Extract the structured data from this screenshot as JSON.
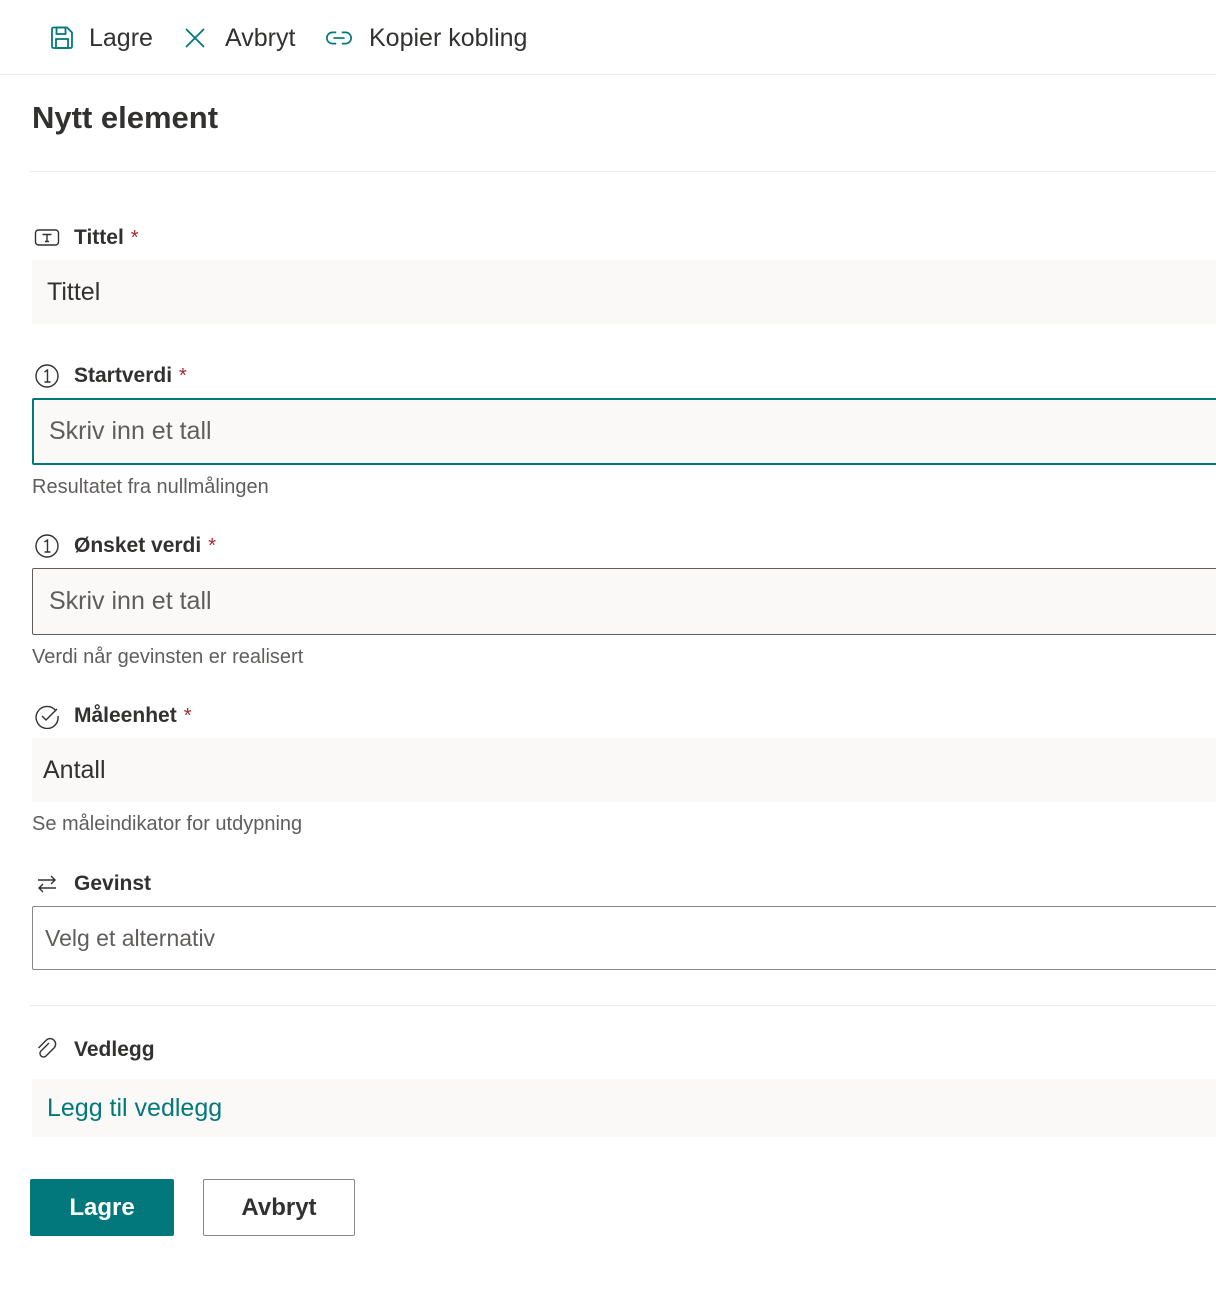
{
  "commandbar": {
    "save_label": "Lagre",
    "cancel_label": "Avbryt",
    "copy_link_label": "Kopier kobling"
  },
  "form": {
    "title": "Nytt element",
    "fields": {
      "tittel": {
        "label": "Tittel",
        "required_mark": "*",
        "value": "Tittel",
        "icon": "text-field-icon"
      },
      "startverdi": {
        "label": "Startverdi",
        "required_mark": "*",
        "placeholder": "Skriv inn et tall",
        "hint": "Resultatet fra nullmålingen",
        "icon": "number-icon"
      },
      "onsket_verdi": {
        "label": "Ønsket verdi",
        "required_mark": "*",
        "placeholder": "Skriv inn et tall",
        "hint": "Verdi når gevinsten er realisert",
        "icon": "number-icon"
      },
      "maleenhet": {
        "label": "Måleenhet",
        "required_mark": "*",
        "value": "Antall",
        "hint": "Se måleindikator for utdypning",
        "icon": "choice-icon"
      },
      "gevinst": {
        "label": "Gevinst",
        "placeholder": "Velg et alternativ",
        "icon": "lookup-icon"
      },
      "vedlegg": {
        "label": "Vedlegg",
        "link_label": "Legg til vedlegg",
        "icon": "paperclip-icon"
      }
    }
  },
  "footer": {
    "save_label": "Lagre",
    "cancel_label": "Avbryt"
  },
  "colors": {
    "accent": "#03787c",
    "required": "#a4262c",
    "text": "#323130",
    "secondary_text": "#605e5c",
    "field_bg": "#faf9f8"
  }
}
